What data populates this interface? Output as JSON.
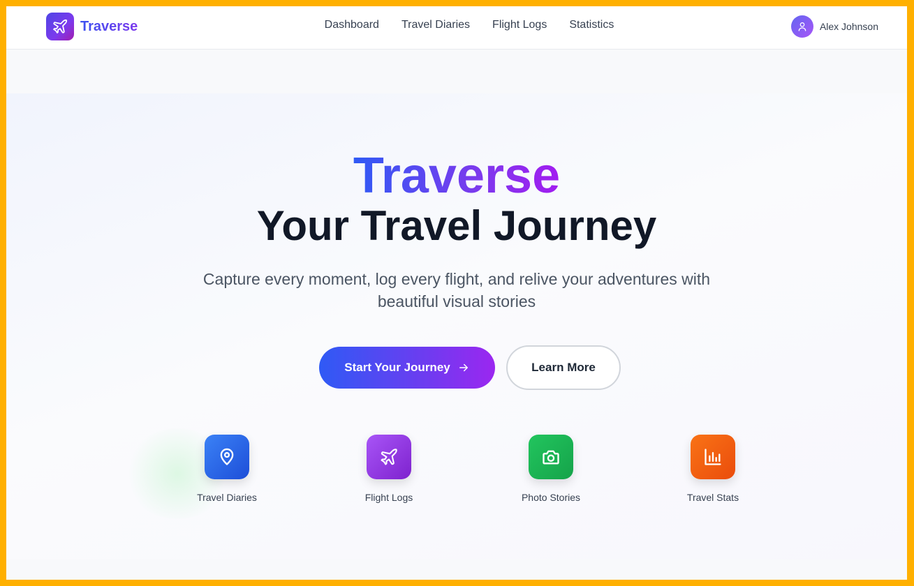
{
  "brand": {
    "name": "Traverse",
    "logo_icon": "plane-icon"
  },
  "nav": {
    "items": [
      {
        "label": "Dashboard"
      },
      {
        "label": "Travel Diaries"
      },
      {
        "label": "Flight Logs"
      },
      {
        "label": "Statistics"
      }
    ]
  },
  "user": {
    "name": "Alex Johnson",
    "avatar_icon": "user-icon"
  },
  "hero": {
    "brand_title": "Traverse",
    "headline": "Your Travel Journey",
    "subtitle": "Capture every moment, log every flight, and relive your adventures with beautiful visual stories",
    "primary_button": "Start Your Journey",
    "secondary_button": "Learn More"
  },
  "features": [
    {
      "label": "Travel Diaries",
      "icon": "map-pin-icon",
      "color": "#3b82f6"
    },
    {
      "label": "Flight Logs",
      "icon": "plane-icon",
      "color": "#a855f7"
    },
    {
      "label": "Photo Stories",
      "icon": "camera-icon",
      "color": "#22c55e"
    },
    {
      "label": "Travel Stats",
      "icon": "bar-chart-icon",
      "color": "#f97316"
    }
  ],
  "colors": {
    "accent_start": "#2f5af5",
    "accent_end": "#9b27f0",
    "page_border": "#ffb000"
  }
}
